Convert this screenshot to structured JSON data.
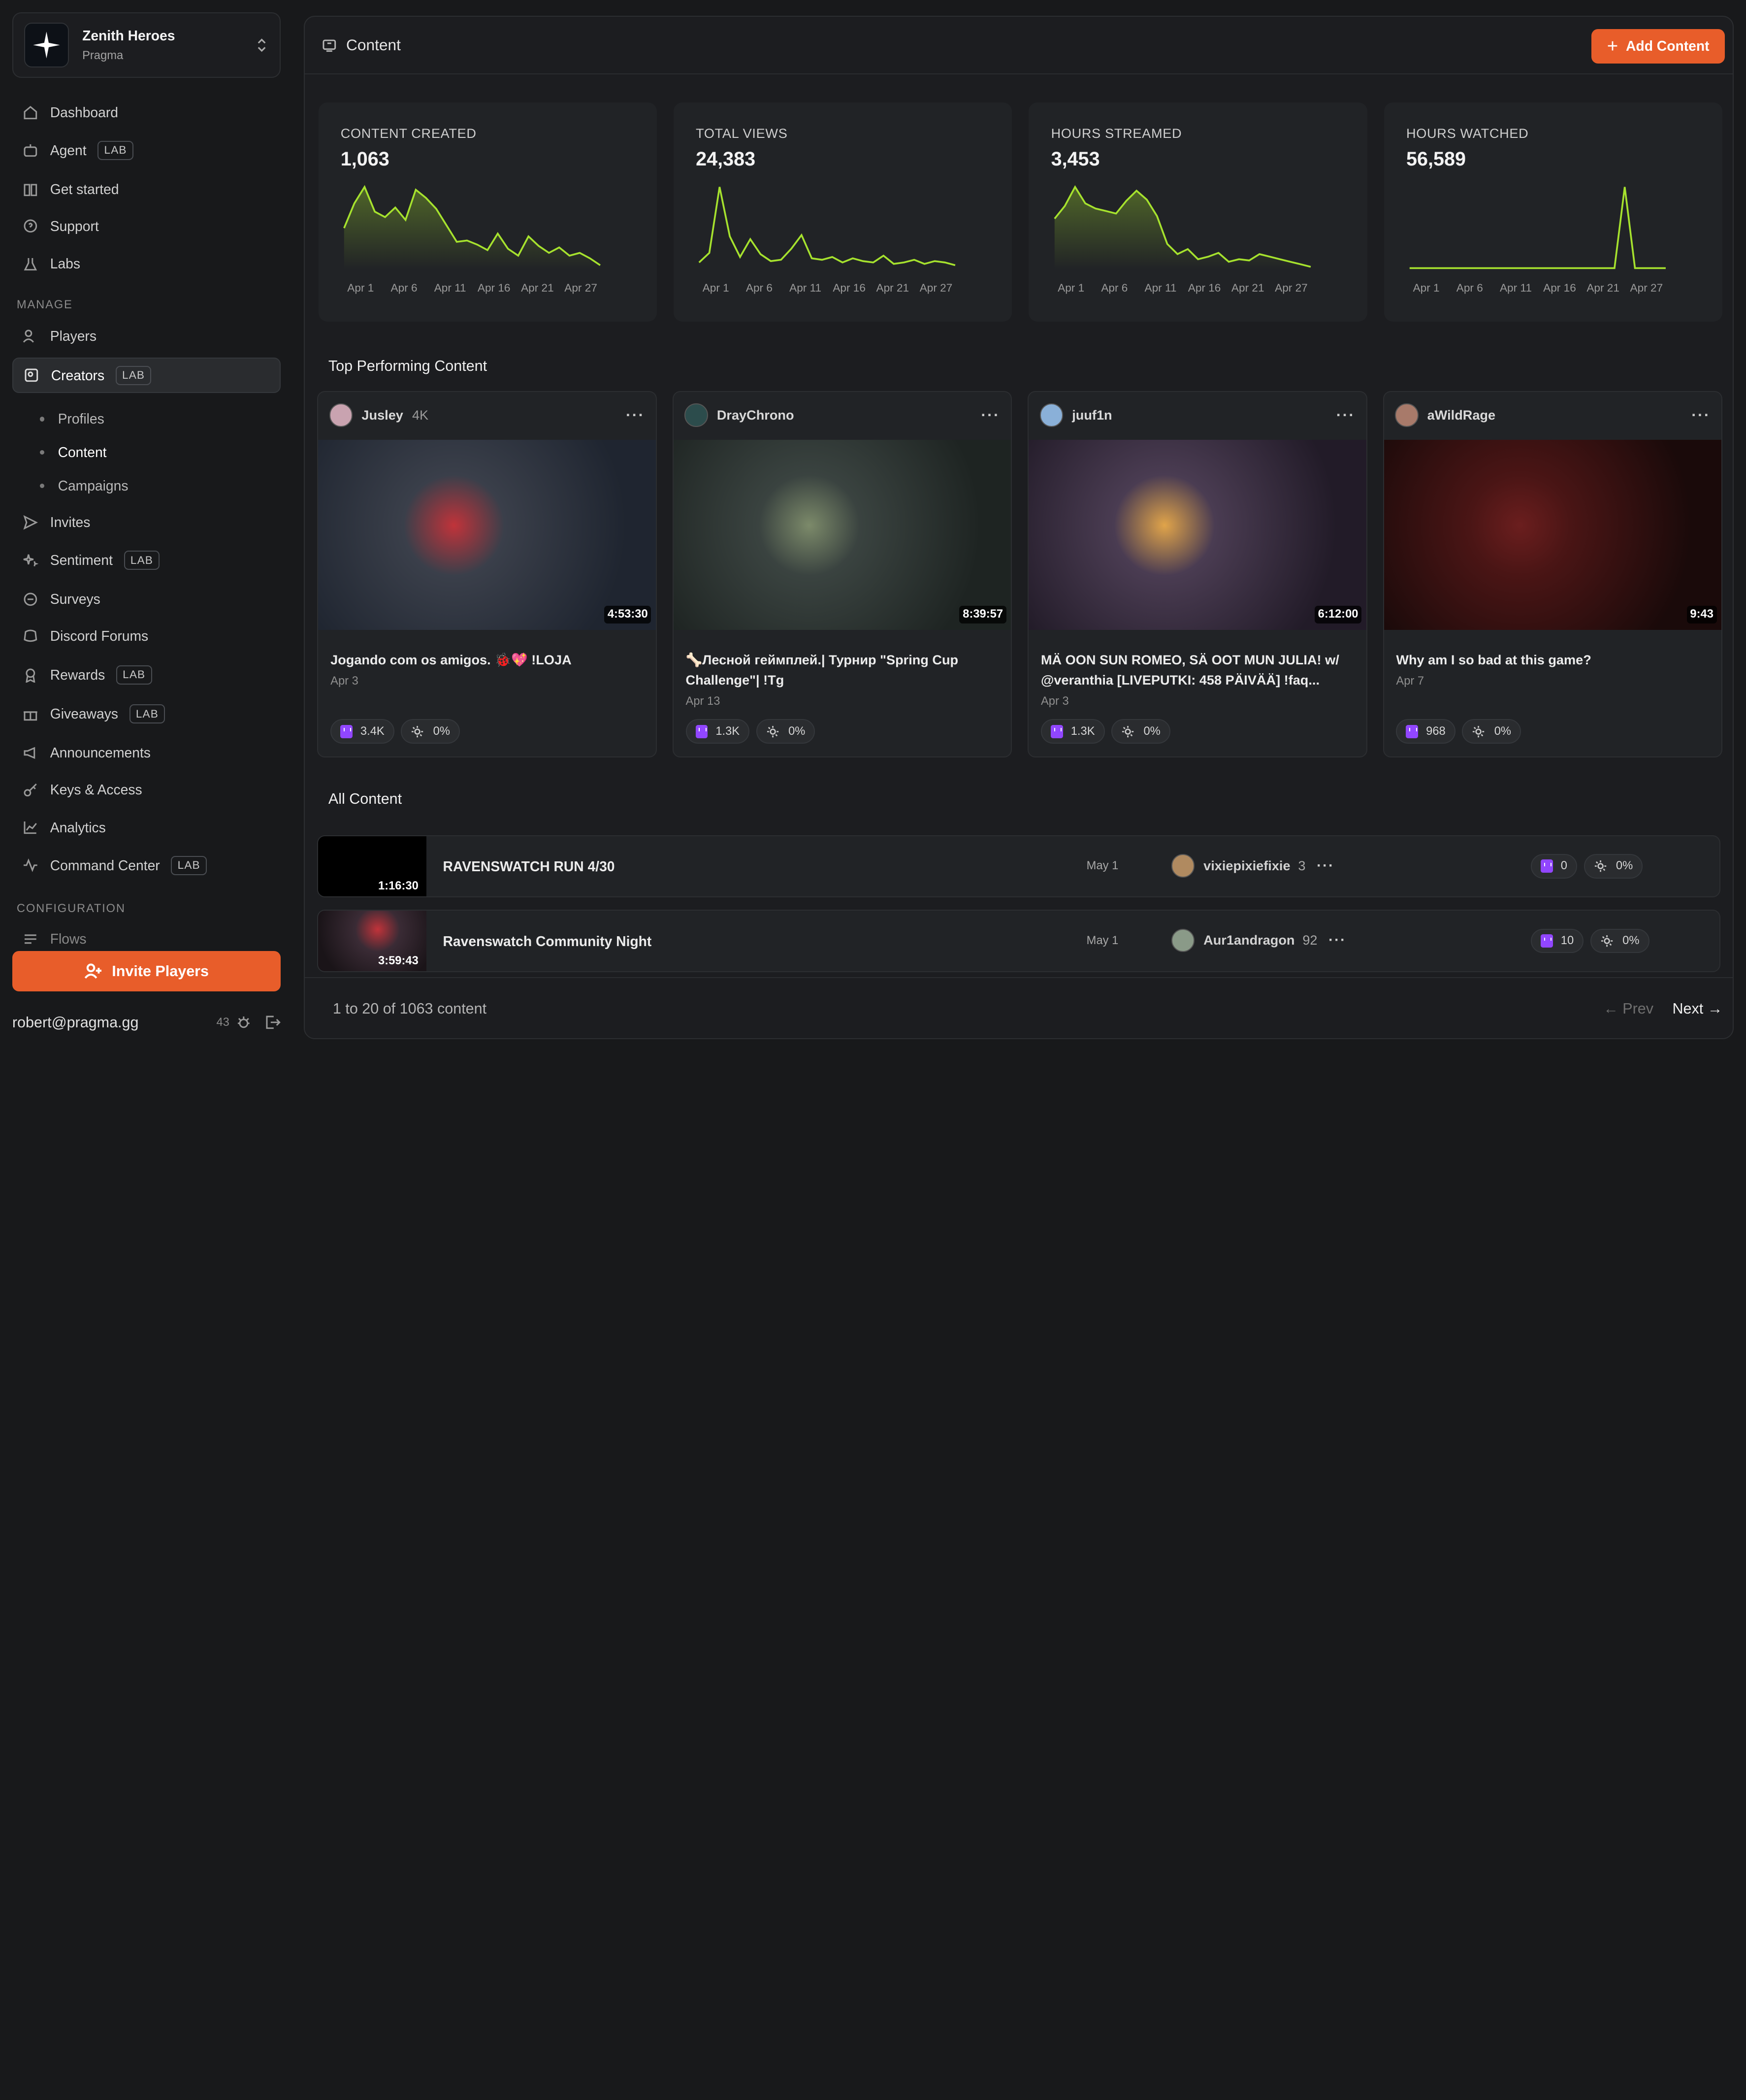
{
  "workspace": {
    "title": "Zenith Heroes",
    "subtitle": "Pragma"
  },
  "sidebar": {
    "items": [
      {
        "label": "Dashboard"
      },
      {
        "label": "Agent",
        "badge": "LAB"
      },
      {
        "label": "Get started"
      },
      {
        "label": "Support"
      },
      {
        "label": "Labs"
      }
    ],
    "manage_label": "MANAGE",
    "manage_items": [
      {
        "label": "Players"
      },
      {
        "label": "Creators",
        "badge": "LAB"
      },
      {
        "label": "Invites"
      },
      {
        "label": "Sentiment",
        "badge": "LAB"
      },
      {
        "label": "Surveys"
      },
      {
        "label": "Discord Forums"
      },
      {
        "label": "Rewards",
        "badge": "LAB"
      },
      {
        "label": "Giveaways",
        "badge": "LAB"
      },
      {
        "label": "Announcements"
      },
      {
        "label": "Keys & Access"
      },
      {
        "label": "Analytics"
      },
      {
        "label": "Command Center",
        "badge": "LAB"
      }
    ],
    "creator_subitems": [
      "Profiles",
      "Content",
      "Campaigns"
    ],
    "config_label": "CONFIGURATION",
    "config_items": [
      {
        "label": "Flows"
      }
    ],
    "invite_button": "Invite Players",
    "user_email": "robert@pragma.gg",
    "user_count": "43"
  },
  "header": {
    "title": "Content",
    "add_button": "Add Content"
  },
  "stats": [
    {
      "label": "CONTENT CREATED",
      "value": "1,063"
    },
    {
      "label": "TOTAL VIEWS",
      "value": "24,383"
    },
    {
      "label": "HOURS STREAMED",
      "value": "3,453"
    },
    {
      "label": "HOURS WATCHED",
      "value": "56,589"
    }
  ],
  "chart_ticks": [
    "Apr 1",
    "Apr 6",
    "Apr 11",
    "Apr 16",
    "Apr 21",
    "Apr 27"
  ],
  "chart_data": [
    {
      "type": "area",
      "title": "CONTENT CREATED",
      "x_ticks": [
        "Apr 1",
        "Apr 6",
        "Apr 11",
        "Apr 16",
        "Apr 21",
        "Apr 27"
      ],
      "values": [
        30,
        48,
        60,
        42,
        38,
        45,
        36,
        58,
        52,
        44,
        32,
        20,
        21,
        18,
        14,
        26,
        15,
        10,
        24,
        17,
        12,
        16,
        10,
        12,
        8,
        3
      ]
    },
    {
      "type": "line",
      "title": "TOTAL VIEWS",
      "x_ticks": [
        "Apr 1",
        "Apr 6",
        "Apr 11",
        "Apr 16",
        "Apr 21",
        "Apr 27"
      ],
      "values": [
        5,
        12,
        60,
        24,
        9,
        22,
        11,
        6,
        7,
        15,
        25,
        8,
        7,
        9,
        5,
        8,
        6,
        5,
        10,
        4,
        5,
        7,
        4,
        6,
        5,
        3
      ]
    },
    {
      "type": "area",
      "title": "HOURS STREAMED",
      "x_ticks": [
        "Apr 1",
        "Apr 6",
        "Apr 11",
        "Apr 16",
        "Apr 21",
        "Apr 27"
      ],
      "values": [
        40,
        50,
        65,
        52,
        48,
        46,
        44,
        54,
        62,
        55,
        42,
        20,
        12,
        16,
        8,
        10,
        13,
        6,
        8,
        7,
        12,
        10,
        8,
        6,
        4,
        2
      ]
    },
    {
      "type": "line",
      "title": "HOURS WATCHED",
      "x_ticks": [
        "Apr 1",
        "Apr 6",
        "Apr 11",
        "Apr 16",
        "Apr 21",
        "Apr 27"
      ],
      "values": [
        1,
        1,
        1,
        1,
        1,
        1,
        1,
        1,
        1,
        1,
        1,
        1,
        1,
        1,
        1,
        1,
        1,
        1,
        1,
        1,
        1,
        70,
        1,
        1,
        1,
        1
      ]
    }
  ],
  "top_section": "Top Performing Content",
  "top_content": [
    {
      "creator": "Jusley",
      "followers": "4K",
      "duration": "4:53:30",
      "title": "Jogando com os amigos. 🐞💖 !LOJA",
      "date": "Apr 3",
      "views": "3.4K",
      "engagement": "0%",
      "avatar_color": "#c9a3b0",
      "thumb_a": "#3a3f4a",
      "thumb_b": "#1f2530",
      "accent": "#c0333a"
    },
    {
      "creator": "DrayChrono",
      "followers": "",
      "duration": "8:39:57",
      "title": "🦴Лесной геймплей.| Турнир \"Spring Cup Challenge\"| !Tg",
      "date": "Apr 13",
      "views": "1.3K",
      "engagement": "0%",
      "avatar_color": "#2c4c4c",
      "thumb_a": "#3a4340",
      "thumb_b": "#1e2422",
      "accent": "#7c8a6a"
    },
    {
      "creator": "juuf1n",
      "followers": "",
      "duration": "6:12:00",
      "title": "MÄ OON SUN ROMEO, SÄ OOT MUN JULIA! w/ @veranthia [LIVEPUTKI: 458 PÄIVÄÄ] !faq...",
      "date": "Apr 3",
      "views": "1.3K",
      "engagement": "0%",
      "avatar_color": "#8ab0d8",
      "thumb_a": "#4a3c52",
      "thumb_b": "#221b28",
      "accent": "#e0a44a"
    },
    {
      "creator": "aWildRage",
      "followers": "",
      "duration": "9:43",
      "title": "Why am I so bad at this game?",
      "date": "Apr 7",
      "views": "968",
      "engagement": "0%",
      "avatar_color": "#a87a6a",
      "thumb_a": "#4a1515",
      "thumb_b": "#1a0a0a",
      "accent": "#6b1e1e"
    }
  ],
  "all_section": "All Content",
  "all_content": [
    {
      "duration": "1:16:30",
      "title": "RAVENSWATCH RUN 4/30",
      "date": "May 1",
      "creator": "vixiepixiefixie",
      "count": "3",
      "views": "0",
      "engagement": "0%",
      "avatar_color": "#b08a60"
    },
    {
      "duration": "3:59:43",
      "title": "Ravenswatch Community Night",
      "date": "May 1",
      "creator": "Aur1andragon",
      "count": "92",
      "views": "10",
      "engagement": "0%",
      "avatar_color": "#8a9a88"
    }
  ],
  "pagination": {
    "summary": "1 to 20 of 1063 content",
    "prev": "Prev",
    "next": "Next"
  },
  "colors": {
    "accent": "#e85d2a",
    "chart_line": "#a6e22e",
    "twitch": "#9146ff"
  }
}
